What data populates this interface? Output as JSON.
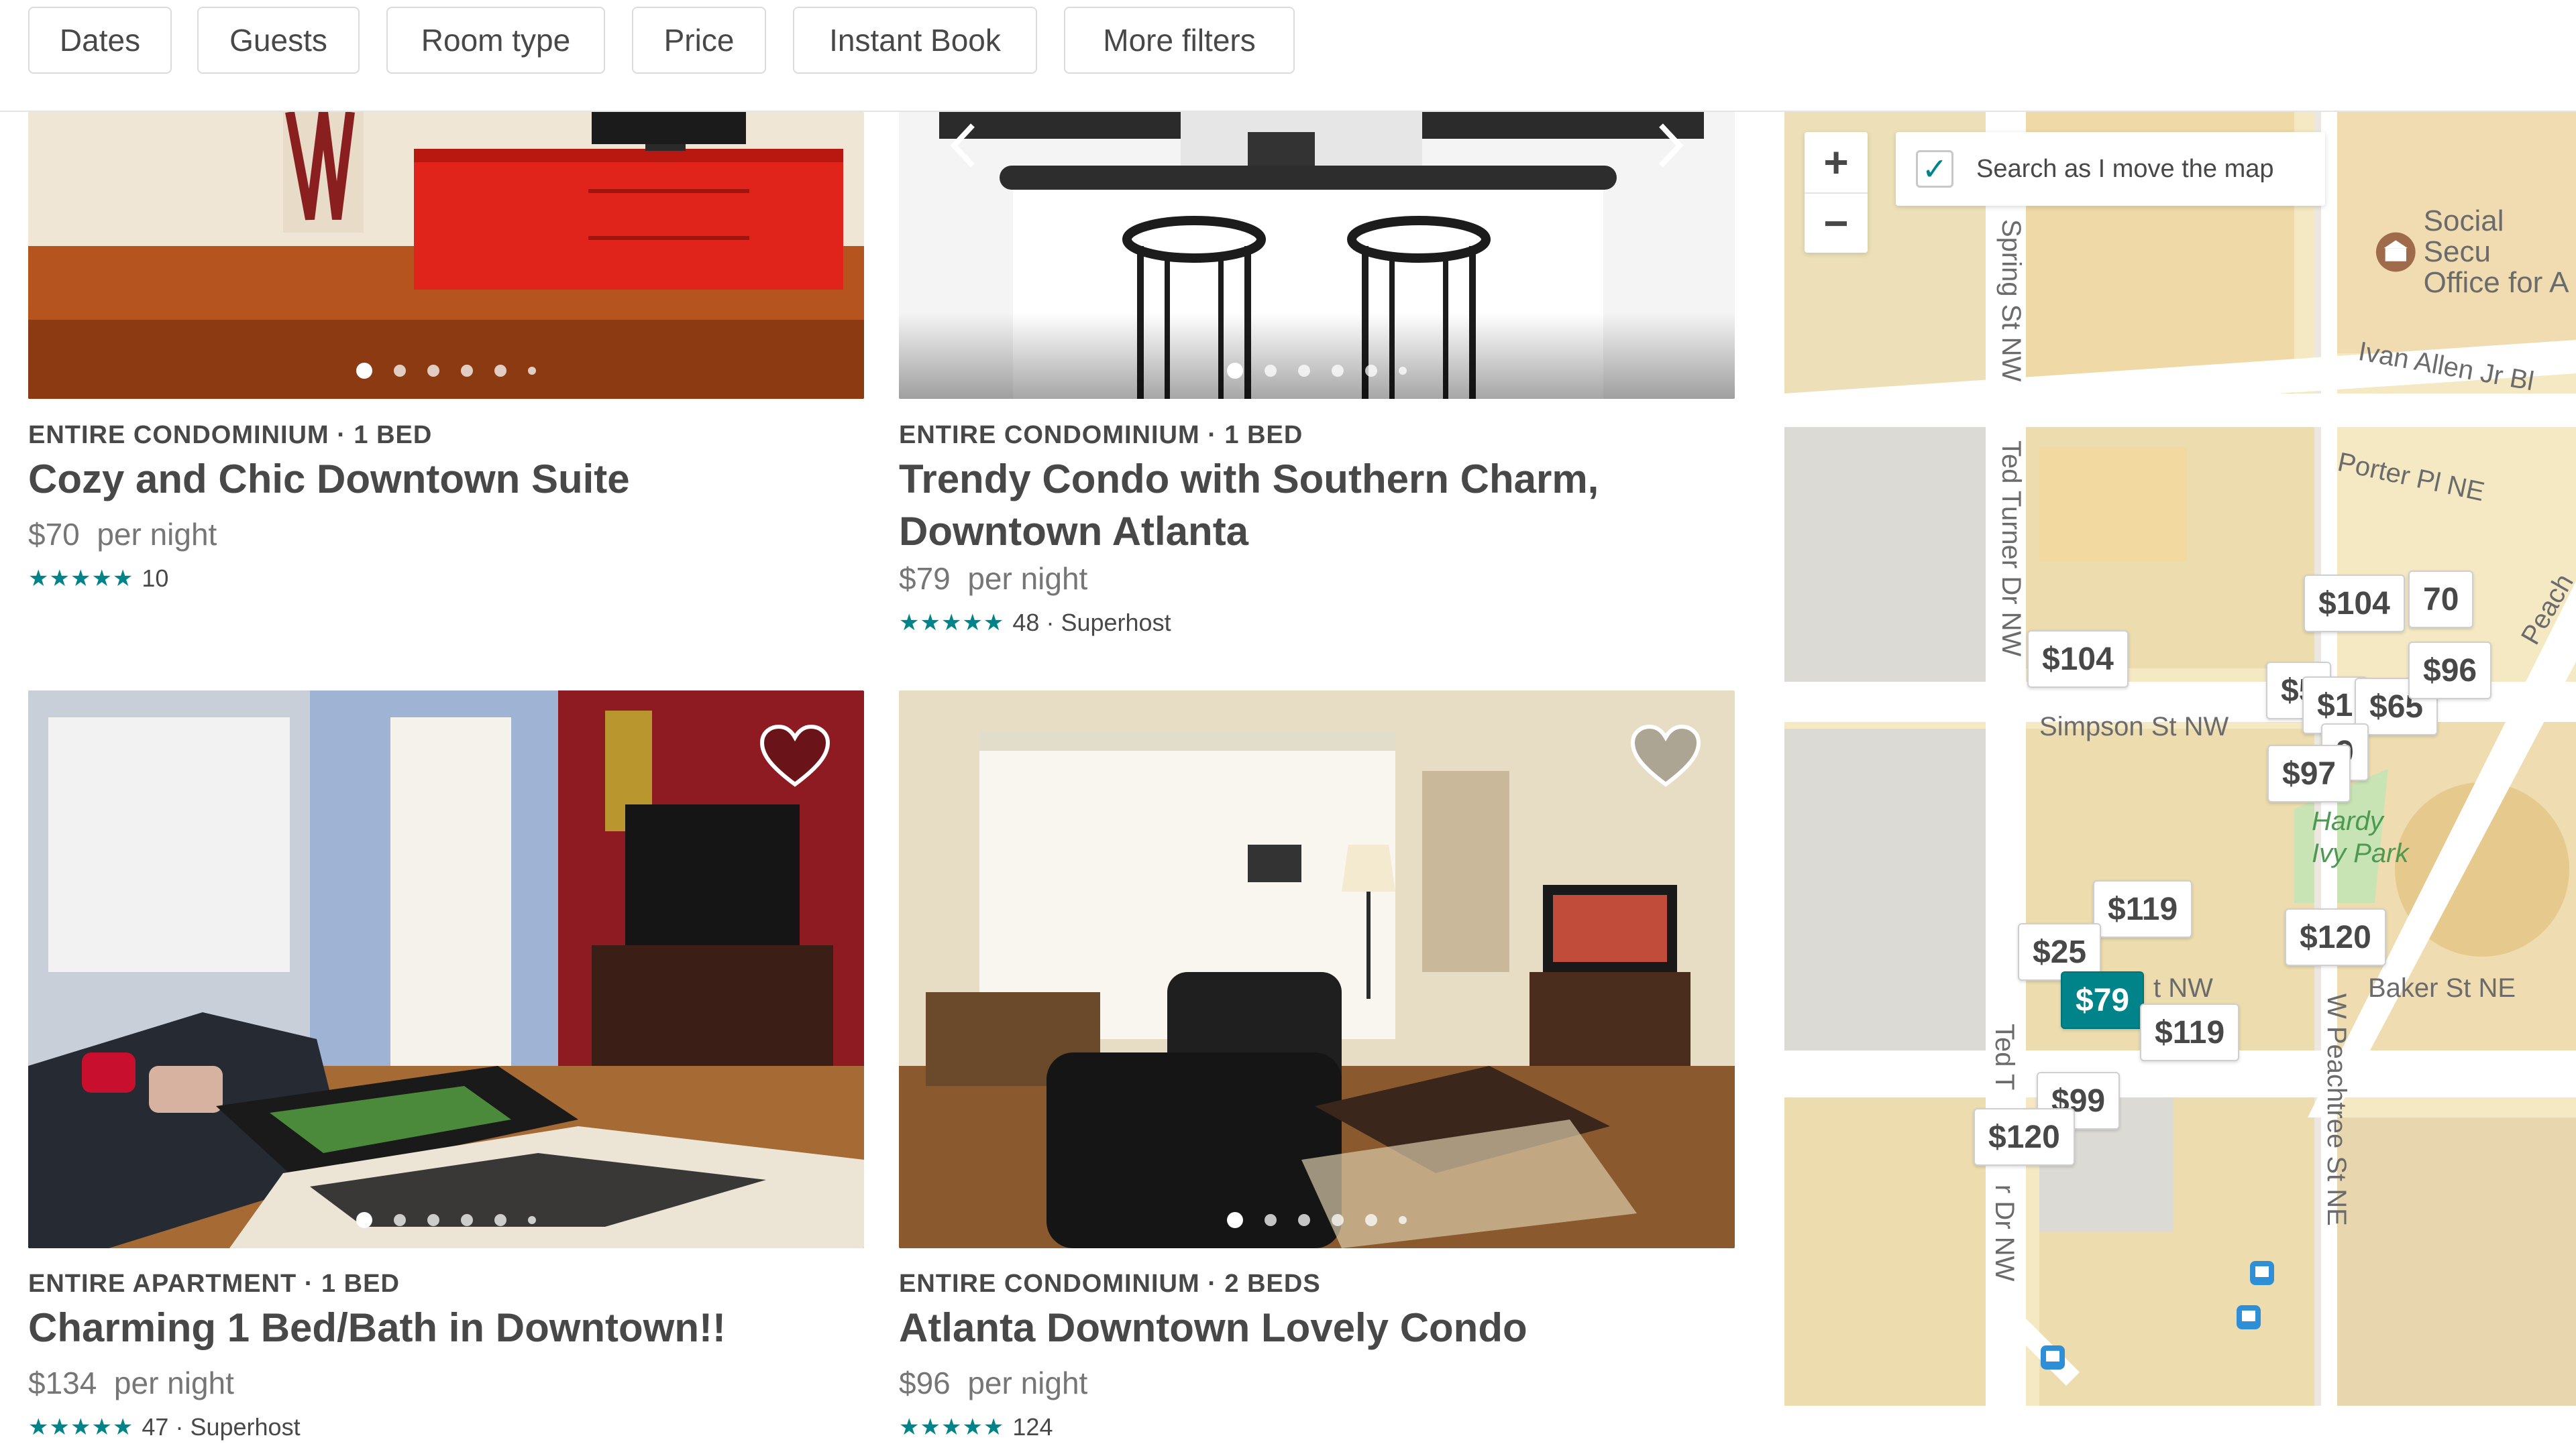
{
  "filters": [
    "Dates",
    "Guests",
    "Room type",
    "Price",
    "Instant Book",
    "More filters"
  ],
  "listings": [
    {
      "type": "ENTIRE CONDOMINIUM · 1 BED",
      "title_lines": [
        "Cozy and Chic Downtown Suite"
      ],
      "price": "$70",
      "per": "per night",
      "stars": "★★★★★",
      "reviews": "10",
      "badge": ""
    },
    {
      "type": "ENTIRE CONDOMINIUM · 1 BED",
      "title_lines": [
        "Trendy Condo with Southern Charm,",
        "Downtown Atlanta"
      ],
      "price": "$79",
      "per": "per night",
      "stars": "★★★★★",
      "reviews": "48",
      "badge": "· Superhost"
    },
    {
      "type": "ENTIRE APARTMENT · 1 BED",
      "title_lines": [
        "Charming 1 Bed/Bath in Downtown!!"
      ],
      "price": "$134",
      "per": "per night",
      "stars": "★★★★★",
      "reviews": "47",
      "badge": "· Superhost"
    },
    {
      "type": "ENTIRE CONDOMINIUM · 2 BEDS",
      "title_lines": [
        "Atlanta Downtown Lovely Condo"
      ],
      "price": "$96",
      "per": "per night",
      "stars": "★★★★★",
      "reviews": "124",
      "badge": ""
    }
  ],
  "map": {
    "zoom_in": "+",
    "zoom_out": "−",
    "search_move_label": "Search as I move the map",
    "search_move_checked": true,
    "streets": {
      "spring": "Spring St NW",
      "ted_turner_1": "Ted Turner Dr NW",
      "ted_turner_2": "Ted T",
      "ted_turner_3": "r Dr NW",
      "ivan_allen": "Ivan Allen Jr Bl",
      "porter": "Porter Pl NE",
      "simpson": "Simpson St NW",
      "baker": "Baker St NE",
      "baker_nw": "t NW",
      "w_peachtree": "W Peachtree St NE",
      "peach": "Peach"
    },
    "poi": {
      "social_security_1": "Social Secu",
      "social_security_2": "Office for A",
      "park_1": "Hardy",
      "park_2": "Ivy Park"
    },
    "pins": [
      "$104",
      "70",
      "$104",
      "$5",
      "$1",
      "$65",
      "$96",
      "9",
      "$97",
      "$119",
      "$120",
      "$25",
      "$79",
      "$119",
      "$99",
      "$120"
    ],
    "selected_pin": "$79"
  },
  "colors": {
    "accent": "#00848a",
    "stars": "#008489",
    "map_base": "#f5e9c4",
    "park": "#c8e4b5"
  }
}
